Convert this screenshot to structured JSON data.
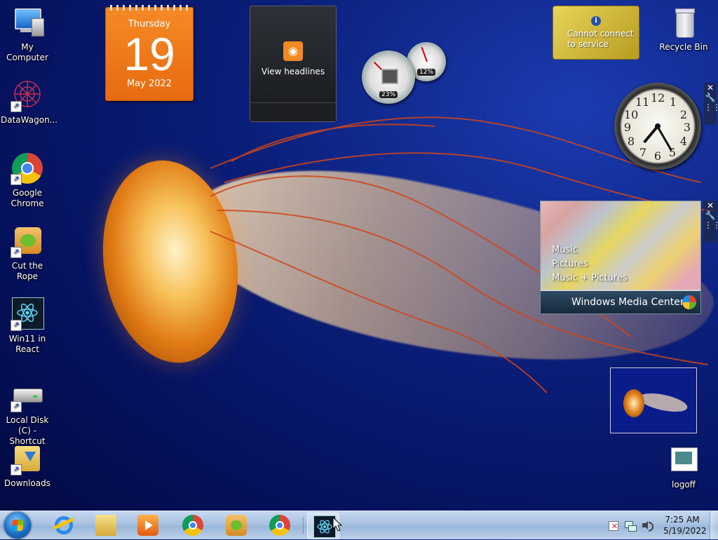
{
  "desktop": {
    "icons_left": [
      {
        "label": "My Computer",
        "icon": "computer-icon"
      },
      {
        "label": "DataWagon...",
        "icon": "datawagon-icon"
      },
      {
        "label": "Google Chrome",
        "icon": "chrome-icon"
      },
      {
        "label": "Cut the Rope",
        "icon": "cut-the-rope-icon"
      },
      {
        "label": "Win11 in React",
        "icon": "react-icon"
      },
      {
        "label": "Local Disk (C) - Shortcut",
        "icon": "drive-icon"
      },
      {
        "label": "Downloads",
        "icon": "downloads-folder-icon"
      }
    ],
    "icons_right": [
      {
        "label": "Recycle Bin",
        "icon": "recycle-bin-icon"
      },
      {
        "label": "logoff",
        "icon": "logoff-icon"
      }
    ]
  },
  "gadgets": {
    "calendar": {
      "weekday": "Thursday",
      "day": "19",
      "month_year": "May 2022"
    },
    "feed": {
      "label": "View headlines",
      "icon": "rss-icon"
    },
    "cpu_meter": {
      "cpu": "23%",
      "memory": "12%",
      "cpu_value": 23,
      "memory_value": 12
    },
    "currency": {
      "message_line1": "Cannot connect",
      "message_line2": "to service",
      "icon": "info-icon"
    },
    "clock": {
      "numbers": [
        "12",
        "1",
        "2",
        "3",
        "4",
        "5",
        "6",
        "7",
        "8",
        "9",
        "10",
        "11"
      ],
      "time": "7:25"
    },
    "media_center": {
      "menu": [
        "Music",
        "Pictures",
        "Music + Pictures"
      ],
      "title": "Windows Media Center"
    },
    "controls": {
      "close": "✕",
      "options": "🔧",
      "drag": "⋮⋮"
    }
  },
  "taskbar": {
    "items": [
      {
        "name": "internet-explorer",
        "icon": "ie-icon"
      },
      {
        "name": "file-explorer",
        "icon": "folder-icon"
      },
      {
        "name": "media-player",
        "icon": "media-player-icon"
      },
      {
        "name": "chrome",
        "icon": "chrome-icon"
      },
      {
        "name": "cut-the-rope",
        "icon": "cut-the-rope-icon"
      },
      {
        "name": "chrome",
        "icon": "chrome-icon"
      },
      {
        "name": "win11-react",
        "icon": "react-icon"
      }
    ],
    "clock": {
      "time": "7:25 AM",
      "date": "5/19/2022"
    },
    "tray_icons": [
      "action-center-icon",
      "network-icon",
      "volume-icon"
    ]
  },
  "colors": {
    "accent": "#1a6fc4",
    "calendar": "#f0781a",
    "wallpaper": "#0a1f7a"
  }
}
